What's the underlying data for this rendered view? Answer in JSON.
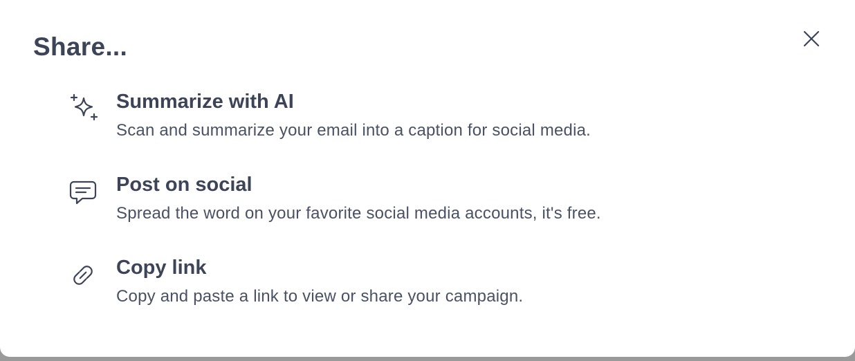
{
  "dialog": {
    "title": "Share...",
    "close_icon": "close-icon"
  },
  "options": [
    {
      "icon": "sparkles-icon",
      "title": "Summarize with AI",
      "description": "Scan and summarize your email into a caption for social media."
    },
    {
      "icon": "chat-bubble-icon",
      "title": "Post on social",
      "description": "Spread the word on your favorite social media accounts, it's free."
    },
    {
      "icon": "link-icon",
      "title": "Copy link",
      "description": "Copy and paste a link to view or share your campaign."
    }
  ],
  "colors": {
    "text_primary": "#3d4458",
    "text_secondary": "#4a5165",
    "background": "#ffffff"
  }
}
